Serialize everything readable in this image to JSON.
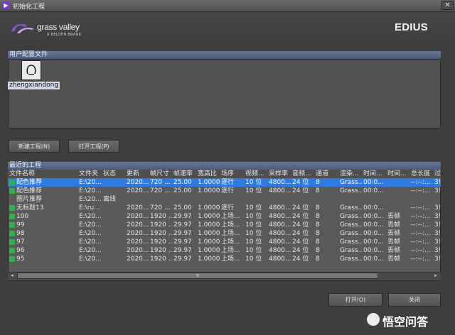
{
  "window": {
    "title": "初始化工程",
    "close_glyph": "✕"
  },
  "brand": {
    "name": "grass valley",
    "sub": "A BELDEN BRAND",
    "product": "EDIUS",
    "logo_color": "#7b3fb3"
  },
  "profiles": {
    "header": "用户配置文件",
    "items": [
      {
        "name": "zhengxiandong"
      }
    ]
  },
  "buttons": {
    "new_project": "新建工程(N)",
    "open_project": "打开工程(P)",
    "open": "打开(O)",
    "close": "关闭"
  },
  "recent": {
    "header": "最近的工程",
    "columns": [
      "文件名称",
      "文件夹",
      "状态",
      "更新",
      "帧尺寸",
      "帧速率",
      "宽高比",
      "场序",
      "视频...",
      "采样率",
      "音频...",
      "通道",
      "渲染...",
      "时间...",
      "时间...",
      "总长度",
      "过"
    ],
    "rows": [
      {
        "name": "配色推荐",
        "folder": "E:\\20...",
        "status": "",
        "updated": "2020...",
        "frame_size": "720 ...",
        "fps": "25.00",
        "aspect": "1.0000",
        "field": "逐行",
        "video": "10 位",
        "sample": "4800...",
        "audio": "24 位",
        "channels": "8",
        "render": "Grass...",
        "time1": "00:0...",
        "time2": "",
        "duration": "--:--:...",
        "extra": "3!",
        "selected": true,
        "icon": true
      },
      {
        "name": "配色推荐",
        "folder": "E:\\20...",
        "status": "",
        "updated": "2020...",
        "frame_size": "720 ...",
        "fps": "25.00",
        "aspect": "1.0000",
        "field": "逐行",
        "video": "10 位",
        "sample": "4800...",
        "audio": "24 位",
        "channels": "8",
        "render": "Grass...",
        "time1": "00:0...",
        "time2": "",
        "duration": "--:--:...",
        "extra": "3!",
        "selected": false,
        "icon": true
      },
      {
        "name": "图片推荐",
        "folder": "E:\\20...",
        "status": "离线",
        "updated": "",
        "frame_size": "",
        "fps": "",
        "aspect": "",
        "field": "",
        "video": "",
        "sample": "",
        "audio": "",
        "channels": "",
        "render": "",
        "time1": "",
        "time2": "",
        "duration": "",
        "extra": "",
        "selected": false,
        "icon": false
      },
      {
        "name": "无标题13",
        "folder": "E:\\ru...",
        "status": "",
        "updated": "2020...",
        "frame_size": "720 ...",
        "fps": "25.00",
        "aspect": "1.0000",
        "field": "逐行",
        "video": "10 位",
        "sample": "4800...",
        "audio": "24 位",
        "channels": "8",
        "render": "Grass...",
        "time1": "00:0...",
        "time2": "",
        "duration": "--:--:...",
        "extra": "3!",
        "selected": false,
        "icon": true
      },
      {
        "name": "100",
        "folder": "E:\\20...",
        "status": "",
        "updated": "2020...",
        "frame_size": "1920 ...",
        "fps": "29.97",
        "aspect": "1.0000",
        "field": "上场...",
        "video": "10 位",
        "sample": "4800...",
        "audio": "24 位",
        "channels": "8",
        "render": "Grass...",
        "time1": "00:0...",
        "time2": "丢帧",
        "duration": "--:--:...",
        "extra": "3!",
        "selected": false,
        "icon": true
      },
      {
        "name": "99",
        "folder": "E:\\20...",
        "status": "",
        "updated": "2020...",
        "frame_size": "1920 ...",
        "fps": "29.97",
        "aspect": "1.0000",
        "field": "上场...",
        "video": "10 位",
        "sample": "4800...",
        "audio": "24 位",
        "channels": "8",
        "render": "Grass...",
        "time1": "00:0...",
        "time2": "丢帧",
        "duration": "--:--:...",
        "extra": "3!",
        "selected": false,
        "icon": true
      },
      {
        "name": "98",
        "folder": "E:\\20...",
        "status": "",
        "updated": "2020...",
        "frame_size": "1920 ...",
        "fps": "29.97",
        "aspect": "1.0000",
        "field": "上场...",
        "video": "10 位",
        "sample": "4800...",
        "audio": "24 位",
        "channels": "8",
        "render": "Grass...",
        "time1": "00:0...",
        "time2": "丢帧",
        "duration": "--:--:...",
        "extra": "3!",
        "selected": false,
        "icon": true
      },
      {
        "name": "97",
        "folder": "E:\\20...",
        "status": "",
        "updated": "2020...",
        "frame_size": "1920 ...",
        "fps": "29.97",
        "aspect": "1.0000",
        "field": "上场...",
        "video": "10 位",
        "sample": "4800...",
        "audio": "24 位",
        "channels": "8",
        "render": "Grass...",
        "time1": "00:0...",
        "time2": "丢帧",
        "duration": "--:--:...",
        "extra": "3!",
        "selected": false,
        "icon": true
      },
      {
        "name": "96",
        "folder": "E:\\20...",
        "status": "",
        "updated": "2020...",
        "frame_size": "1920 ...",
        "fps": "29.97",
        "aspect": "1.0000",
        "field": "上场...",
        "video": "10 位",
        "sample": "4800...",
        "audio": "24 位",
        "channels": "8",
        "render": "Grass...",
        "time1": "00:0...",
        "time2": "丢帧",
        "duration": "--:--:...",
        "extra": "3!",
        "selected": false,
        "icon": true
      },
      {
        "name": "95",
        "folder": "E:\\20...",
        "status": "",
        "updated": "2020...",
        "frame_size": "1920 ...",
        "fps": "29.97",
        "aspect": "1.0000",
        "field": "上场...",
        "video": "10 位",
        "sample": "4800...",
        "audio": "24 位",
        "channels": "8",
        "render": "Grass...",
        "time1": "00:0...",
        "time2": "丢帧",
        "duration": "--:--:...",
        "extra": "3!",
        "selected": false,
        "icon": true
      }
    ]
  },
  "scrollbar": {
    "left_glyph": "◂",
    "right_glyph": "▸",
    "thumb_glyph": "≡"
  },
  "watermark": {
    "text": "悟空问答"
  }
}
